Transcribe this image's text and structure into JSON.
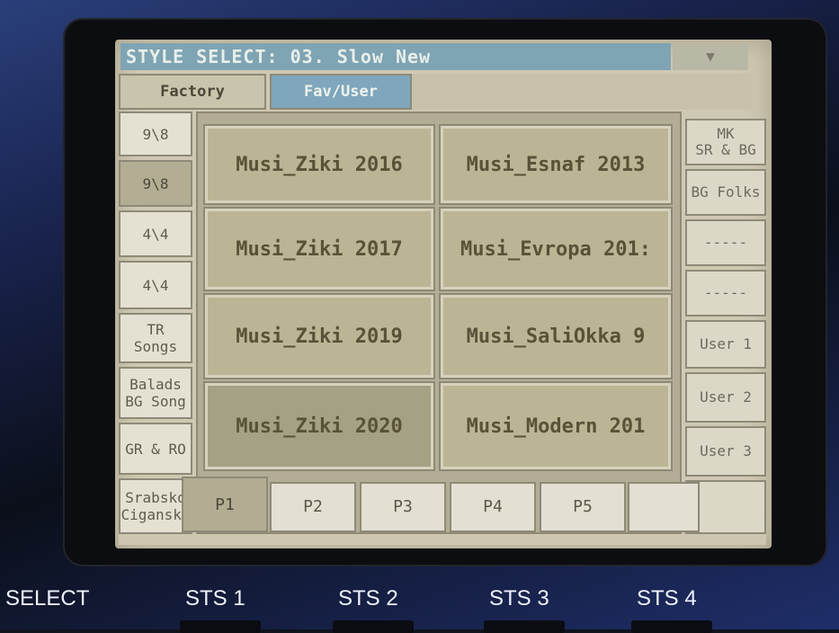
{
  "title_bar": {
    "text": "STYLE SELECT: 03. Slow New",
    "arrow": "▼"
  },
  "top_tabs": [
    {
      "label": "Factory",
      "selected": false
    },
    {
      "label": "Fav/User",
      "selected": true
    }
  ],
  "left_banks": [
    [
      "9\\8"
    ],
    [
      "9\\8"
    ],
    [
      "4\\4"
    ],
    [
      "4\\4"
    ],
    [
      "TR",
      "Songs"
    ],
    [
      "Balads",
      "BG Song"
    ],
    [
      "GR & RO"
    ],
    [
      "Srabsko",
      "Ciganski"
    ]
  ],
  "left_selected_index": 1,
  "styles": [
    [
      "Musi_Ziki 2016",
      "Musi_Esnaf 2013"
    ],
    [
      "Musi_Ziki 2017",
      "Musi_Evropa 201:"
    ],
    [
      "Musi_Ziki 2019",
      "Musi_SaliOkka 9"
    ],
    [
      "Musi_Ziki 2020",
      "Musi_Modern 201"
    ]
  ],
  "selected_style": "Musi_Ziki 2020",
  "right_banks": [
    [
      "MK",
      "SR & BG"
    ],
    [
      "BG Folks"
    ],
    [
      "-----"
    ],
    [
      "-----"
    ],
    [
      "User 1"
    ],
    [
      "User 2"
    ],
    [
      "User 3"
    ],
    [
      ""
    ]
  ],
  "page_tabs": [
    "P1",
    "P2",
    "P3",
    "P4",
    "P5",
    ""
  ],
  "page_selected_index": 0,
  "hardware_buttons": [
    "SELECT",
    "STS 1",
    "STS 2",
    "STS 3",
    "STS 4"
  ],
  "colors": {
    "title_bar_bg": "#7fa4b4",
    "screen_bg": "#cfc9b4",
    "selected_bg": "#b3ae93"
  }
}
